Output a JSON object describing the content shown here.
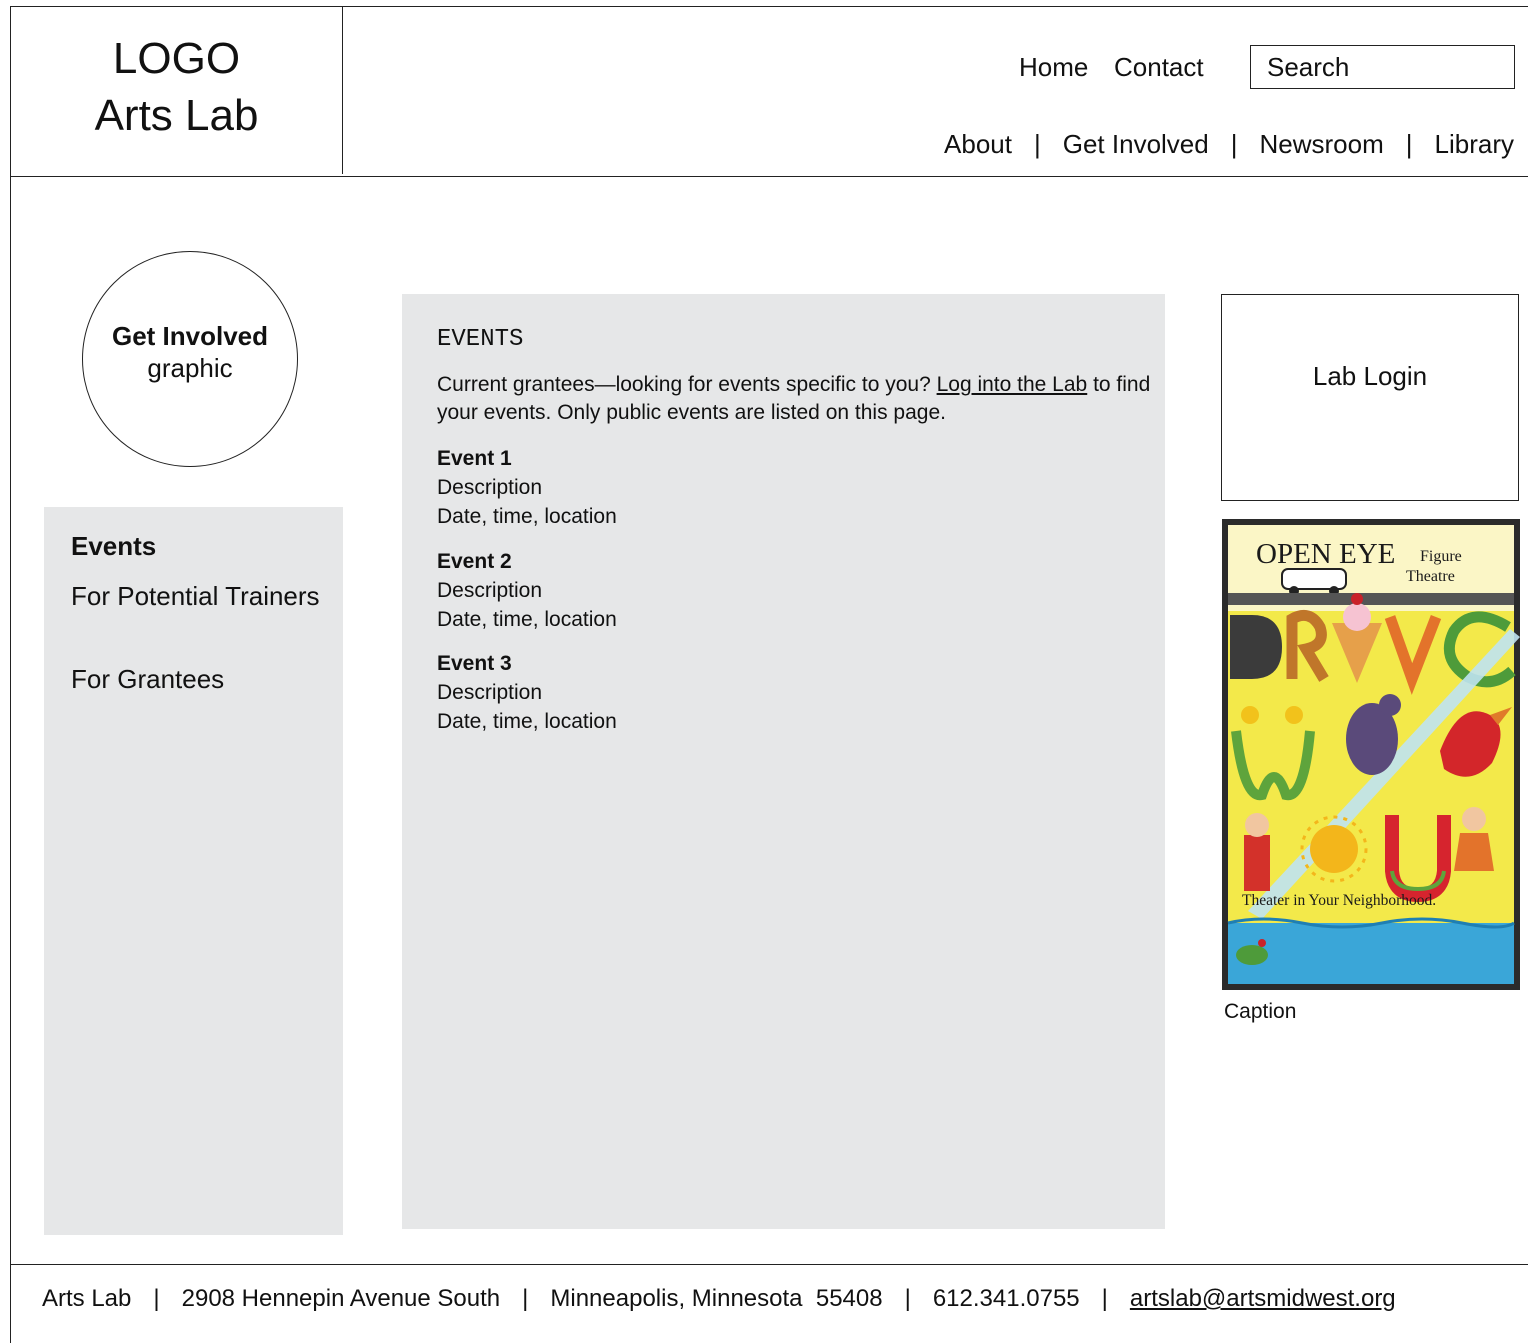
{
  "header": {
    "logo_line1": "LOGO",
    "logo_line2": "Arts Lab",
    "utility_nav": {
      "home": "Home",
      "contact": "Contact"
    },
    "search": {
      "placeholder": "Search"
    },
    "main_nav": {
      "about": "About",
      "get_involved": "Get Involved",
      "newsroom": "Newsroom",
      "library": "Library",
      "separator": "|"
    }
  },
  "left": {
    "graphic": {
      "title": "Get Involved",
      "subtitle": "graphic"
    },
    "sidebar": {
      "items": [
        "Events",
        "For Potential Trainers",
        "For Grantees"
      ],
      "active_index": 0
    }
  },
  "main": {
    "heading": "EVENTS",
    "intro_before": "Current grantees—looking for events specific to you? ",
    "intro_link": "Log into the Lab",
    "intro_after": " to find your events. Only public events are listed on this page.",
    "events": [
      {
        "title": "Event 1",
        "description": "Description",
        "details": "Date, time, location"
      },
      {
        "title": "Event 2",
        "description": "Description",
        "details": "Date, time, location"
      },
      {
        "title": "Event 3",
        "description": "Description",
        "details": "Date, time, location"
      }
    ]
  },
  "right": {
    "login_label": "Lab Login",
    "poster": {
      "title": "OPEN EYE",
      "title_small_1": "Figure",
      "title_small_2": "Theatre",
      "tagline": "Theater in Your Neighborhood."
    },
    "caption": "Caption"
  },
  "footer": {
    "name": "Arts Lab",
    "address": "2908 Hennepin Avenue South",
    "city": "Minneapolis, Minnesota  55408",
    "phone": "612.341.0755",
    "email": "artslab@artsmidwest.org",
    "separator": "|"
  },
  "colors": {
    "panel_gray": "#e6e7e8",
    "rule": "#222222",
    "poster_yellow": "#f3e94a",
    "poster_blue": "#3aa6d8"
  }
}
